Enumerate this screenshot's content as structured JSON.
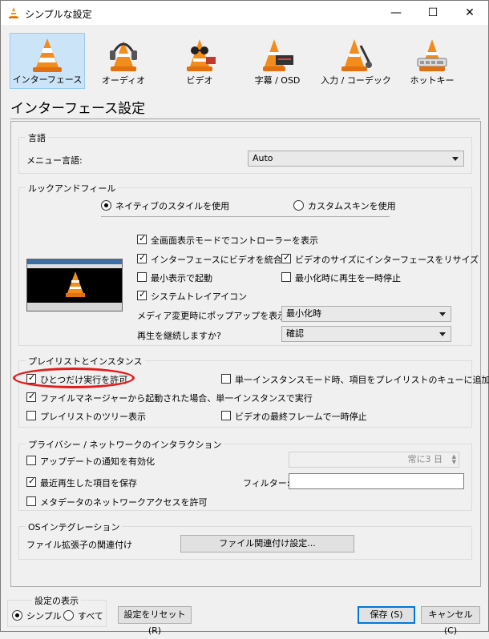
{
  "window": {
    "title": "シンプルな設定",
    "minimize": "—",
    "maximize": "☐",
    "close": "✕"
  },
  "categories": [
    {
      "label": "インターフェース",
      "icon": "interface-cone-icon"
    },
    {
      "label": "オーディオ",
      "icon": "audio-headphones-cone-icon"
    },
    {
      "label": "ビデオ",
      "icon": "video-glasses-cone-icon"
    },
    {
      "label": "字幕 / OSD",
      "icon": "subtitles-cone-icon"
    },
    {
      "label": "入力 / コーデック",
      "icon": "input-codecs-cone-icon"
    },
    {
      "label": "ホットキー",
      "icon": "hotkeys-cone-icon"
    }
  ],
  "page_title": "インターフェース設定",
  "language": {
    "group": "言語",
    "menu_label": "メニュー言語:",
    "menu_value": "Auto"
  },
  "look": {
    "group": "ルックアンドフィール",
    "radio_native": "ネイティブのスタイルを使用",
    "radio_custom": "カスタムスキンを使用",
    "cb_fullscreen_controller": "全画面表示モードでコントローラーを表示",
    "cb_embed_video": "インターフェースにビデオを統合",
    "cb_resize_interface": "ビデオのサイズにインターフェースをリサイズ",
    "cb_start_minimal": "最小表示で起動",
    "cb_pause_minimized": "最小化時に再生を一時停止",
    "cb_systray": "システムトレイアイコン",
    "popup_label": "メディア変更時にポップアップを表示:",
    "popup_value": "最小化時",
    "continue_label": "再生を継続しますか?",
    "continue_value": "確認"
  },
  "playlist": {
    "group": "プレイリストとインスタンス",
    "cb_one_instance": "ひとつだけ実行を許可",
    "cb_enqueue_one_instance": "単一インスタンスモード時、項目をプレイリストのキューに追加",
    "cb_file_manager_instance": "ファイルマネージャーから起動された場合、単一インスタンスで実行",
    "cb_tree_view": "プレイリストのツリー表示",
    "cb_pause_last_frame": "ビデオの最終フレームで一時停止"
  },
  "privacy": {
    "group": "プライバシー / ネットワークのインタラクション",
    "cb_update_notify": "アップデートの通知を有効化",
    "update_interval": "常に3 日",
    "cb_save_recent": "最近再生した項目を保存",
    "filter_label": "フィルター:",
    "filter_value": "",
    "cb_metadata_network": "メタデータのネットワークアクセスを許可"
  },
  "os": {
    "group": "OSインテグレーション",
    "assoc_label": "ファイル拡張子の関連付け",
    "assoc_button": "ファイル関連付け設定..."
  },
  "footer": {
    "show_label": "設定の表示",
    "radio_simple": "シンプル",
    "radio_all": "すべて",
    "reset_button": "設定をリセット (R)",
    "save_button": "保存 (S)",
    "cancel_button": "キャンセル (C)"
  },
  "checked": {
    "native_style": true,
    "fullscreen_controller": true,
    "embed_video": true,
    "resize_interface": true,
    "start_minimal": false,
    "pause_minimized": false,
    "systray": true,
    "one_instance": true,
    "enqueue_one_instance": false,
    "file_manager_instance": true,
    "tree_view": false,
    "pause_last_frame": false,
    "update_notify": false,
    "save_recent": true,
    "metadata_network": false,
    "show_simple": true
  },
  "colors": {
    "accent": "#0078d7",
    "selection": "#cce4f7",
    "annotation": "#e21c1c",
    "cone_orange": "#f28c1c"
  }
}
